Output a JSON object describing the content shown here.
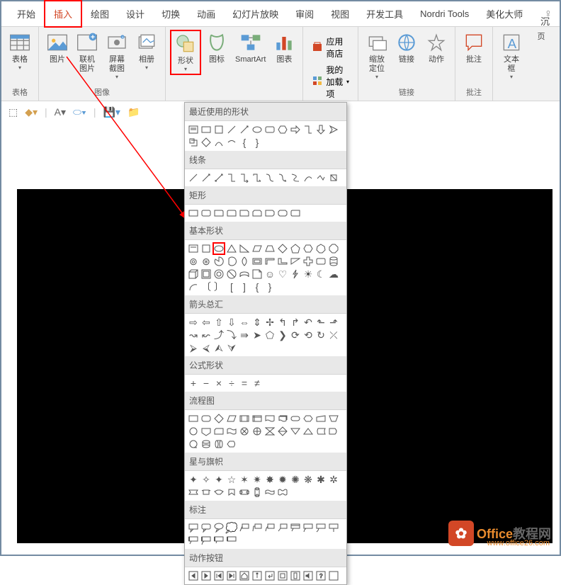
{
  "tabs": {
    "start": "开始",
    "insert": "插入",
    "draw": "绘图",
    "design": "设计",
    "transition": "切换",
    "animation": "动画",
    "slideshow": "幻灯片放映",
    "review": "审阅",
    "view": "视图",
    "devtools": "开发工具",
    "nordri": "Nordri Tools",
    "beautify": "美化大师"
  },
  "title_right": "沉",
  "groups": {
    "table": {
      "label": "表格",
      "btn": "表格"
    },
    "image": {
      "label": "图像",
      "pic": "图片",
      "online": "联机图片",
      "screenshot": "屏幕截图",
      "album": "相册"
    },
    "illust": {
      "shapes": "形状",
      "icons": "图标",
      "smartart": "SmartArt",
      "chart": "图表"
    },
    "addins": {
      "store": "应用商店",
      "myaddins": "我的加载项"
    },
    "links": {
      "label": "链接",
      "zoom": "缩放定位",
      "hyperlink": "链接",
      "action": "动作"
    },
    "comments": {
      "label": "批注",
      "comment": "批注"
    },
    "text": {
      "textbox": "文本框",
      "header": "页"
    }
  },
  "dropdown": {
    "recent": "最近使用的形状",
    "lines": "线条",
    "rects": "矩形",
    "basic": "基本形状",
    "arrows": "箭头总汇",
    "equation": "公式形状",
    "flowchart": "流程图",
    "stars": "星与旗帜",
    "callouts": "标注",
    "actions": "动作按钮"
  },
  "watermark": {
    "brand1": "Office",
    "brand2": "教程网",
    "url": "www.office26.com"
  }
}
